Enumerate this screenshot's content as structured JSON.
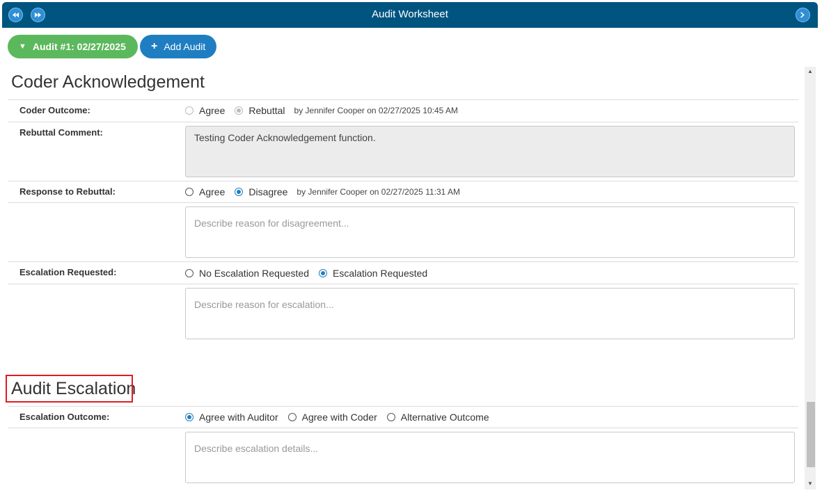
{
  "window": {
    "title": "Audit Worksheet",
    "nav_icons": [
      "double-chevron-left-icon",
      "double-chevron-right-icon",
      "chevron-right-icon"
    ]
  },
  "toolbar": {
    "audit_label": "Audit #1: 02/27/2025",
    "add_label": "Add Audit"
  },
  "coder_ack": {
    "heading": "Coder Acknowledgement",
    "outcome": {
      "label": "Coder Outcome:",
      "options": [
        "Agree",
        "Rebuttal"
      ],
      "selected": "Rebuttal",
      "byline": "by Jennifer Cooper on 02/27/2025 10:45 AM"
    },
    "rebuttal": {
      "label": "Rebuttal Comment:",
      "value": "Testing Coder Acknowledgement function."
    },
    "response": {
      "label": "Response to Rebuttal:",
      "options": [
        "Agree",
        "Disagree"
      ],
      "selected": "Disagree",
      "byline": "by Jennifer Cooper on 02/27/2025 11:31 AM",
      "placeholder": "Describe reason for disagreement..."
    },
    "escalation": {
      "label": "Escalation Requested:",
      "options": [
        "No Escalation Requested",
        "Escalation Requested"
      ],
      "selected": "Escalation Requested",
      "placeholder": "Describe reason for escalation..."
    }
  },
  "audit_escalation": {
    "heading": "Audit Escalation",
    "outcome": {
      "label": "Escalation Outcome:",
      "options": [
        "Agree with Auditor",
        "Agree with Coder",
        "Alternative Outcome"
      ],
      "selected": "Agree with Auditor",
      "placeholder": "Describe escalation details..."
    }
  },
  "colors": {
    "titlebar": "#005580",
    "green_button": "#5cb85c",
    "blue_button": "#1f7ec1",
    "highlight": "#e01b24"
  }
}
